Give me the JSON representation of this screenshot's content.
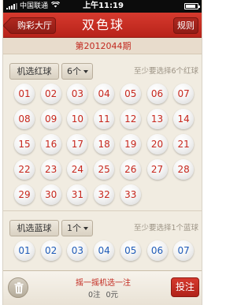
{
  "status_bar": {
    "carrier": "中国联通",
    "time": "上午11:19",
    "battery_level": 0.85
  },
  "header": {
    "back_label": "购彩大厅",
    "title": "双色球",
    "rules_label": "规则"
  },
  "issue": {
    "label": "第2012044期"
  },
  "red_section": {
    "pick_label": "机选红球",
    "count_value": "6个",
    "hint": "至少要选择6个红球",
    "balls": [
      "01",
      "02",
      "03",
      "04",
      "05",
      "06",
      "07",
      "08",
      "09",
      "10",
      "11",
      "12",
      "13",
      "14",
      "15",
      "16",
      "17",
      "18",
      "19",
      "20",
      "21",
      "22",
      "23",
      "24",
      "25",
      "26",
      "27",
      "28",
      "29",
      "30",
      "31",
      "32",
      "33"
    ]
  },
  "blue_section": {
    "pick_label": "机选蓝球",
    "count_value": "1个",
    "hint": "至少要选择1个蓝球",
    "balls": [
      "01",
      "02",
      "03",
      "04",
      "05",
      "06",
      "07"
    ]
  },
  "footer": {
    "shake_text": "摇一摇机选一注",
    "bets": "0注",
    "amount": "0元",
    "bet_label": "投注"
  },
  "colors": {
    "accent_red": "#c2291f",
    "ball_red_text": "#c7271d",
    "ball_blue_text": "#1e5bb8"
  }
}
